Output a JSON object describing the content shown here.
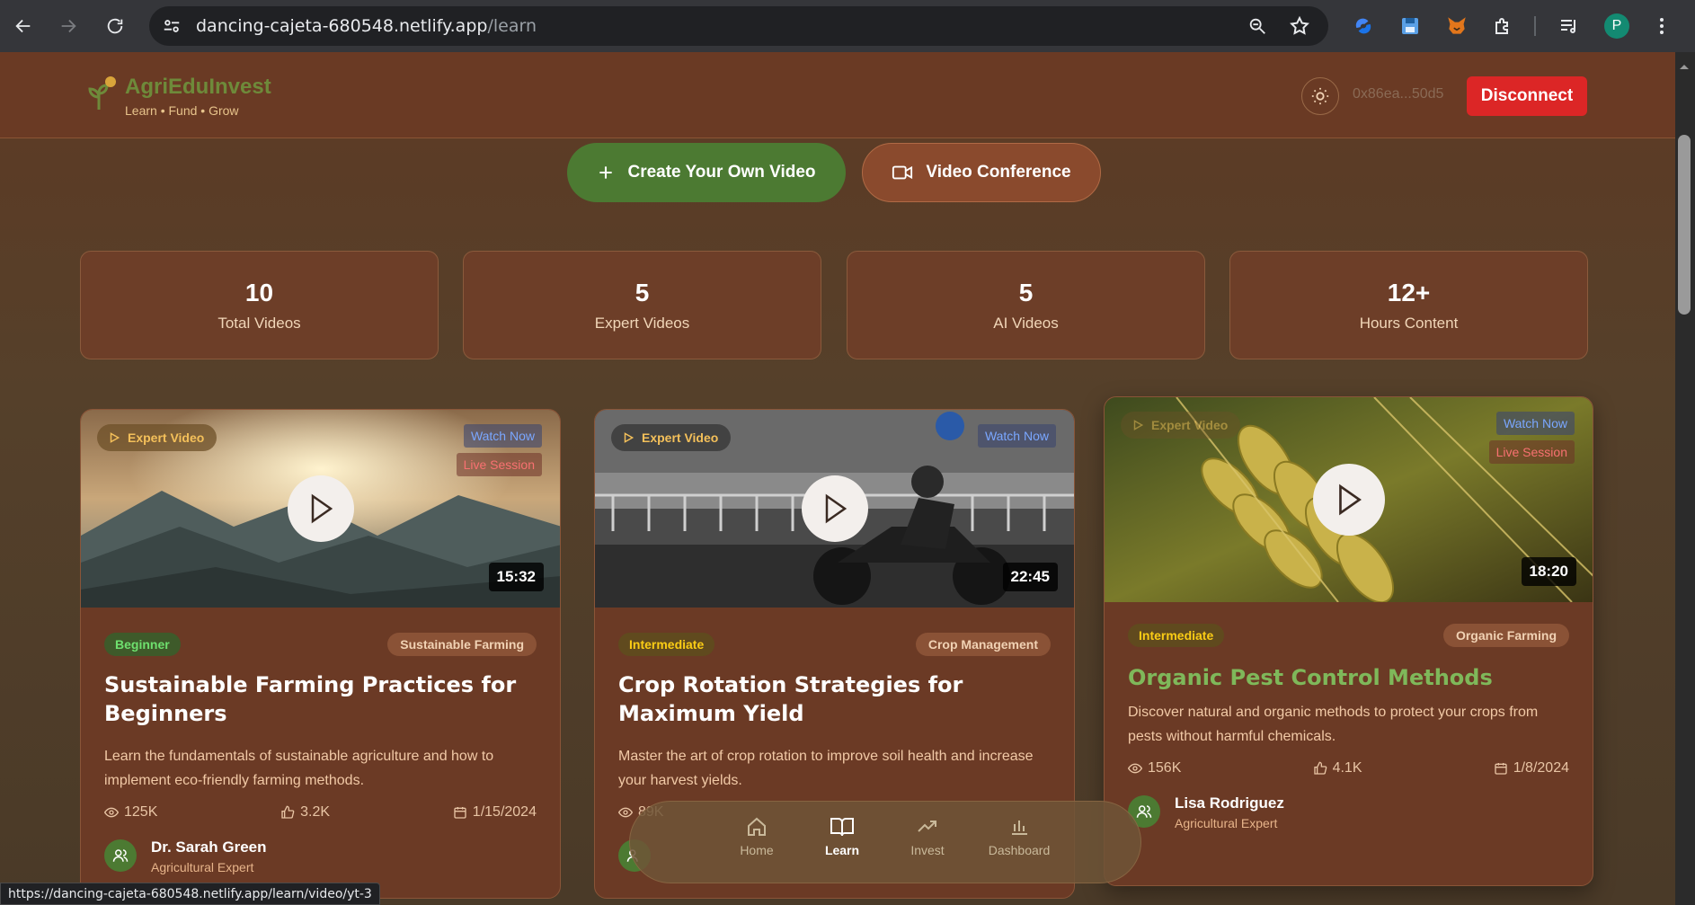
{
  "browser": {
    "url_host": "dancing-cajeta-680548.netlify.app",
    "url_path": "/learn",
    "profile_initial": "P",
    "status_url": "https://dancing-cajeta-680548.netlify.app/learn/video/yt-3"
  },
  "header": {
    "brand": "AgriEduInvest",
    "tagline": "Learn • Fund • Grow",
    "wallet": "0x86ea...50d5",
    "disconnect_label": "Disconnect"
  },
  "actions": {
    "create_label": "Create Your Own Video",
    "conference_label": "Video Conference"
  },
  "stats": [
    {
      "value": "10",
      "label": "Total Videos"
    },
    {
      "value": "5",
      "label": "Expert Videos"
    },
    {
      "value": "5",
      "label": "AI Videos"
    },
    {
      "value": "12+",
      "label": "Hours Content"
    }
  ],
  "videos": [
    {
      "badge": "Expert Video",
      "watch": "Watch Now",
      "live": "Live Session",
      "duration": "15:32",
      "level": "Beginner",
      "category": "Sustainable Farming",
      "title": "Sustainable Farming Practices for Beginners",
      "description": "Learn the fundamentals of sustainable agriculture and how to implement eco-friendly farming methods.",
      "views": "125K",
      "likes": "3.2K",
      "date": "1/15/2024",
      "author": "Dr. Sarah Green",
      "role": "Agricultural Expert"
    },
    {
      "badge": "Expert Video",
      "watch": "Watch Now",
      "duration": "22:45",
      "level": "Intermediate",
      "category": "Crop Management",
      "title": "Crop Rotation Strategies for Maximum Yield",
      "description": "Master the art of crop rotation to improve soil health and increase your harvest yields.",
      "views": "89K"
    },
    {
      "badge": "Expert Video",
      "watch": "Watch Now",
      "live": "Live Session",
      "duration": "18:20",
      "level": "Intermediate",
      "category": "Organic Farming",
      "title": "Organic Pest Control Methods",
      "description": "Discover natural and organic methods to protect your crops from pests without harmful chemicals.",
      "views": "156K",
      "likes": "4.1K",
      "date": "1/8/2024",
      "author": "Lisa Rodriguez",
      "role": "Agricultural Expert"
    }
  ],
  "bottom_nav": [
    {
      "label": "Home"
    },
    {
      "label": "Learn"
    },
    {
      "label": "Invest"
    },
    {
      "label": "Dashboard"
    }
  ],
  "colors": {
    "accent_green": "#4c7a32",
    "danger": "#dc2626",
    "card_bg": "#6b3a25"
  }
}
